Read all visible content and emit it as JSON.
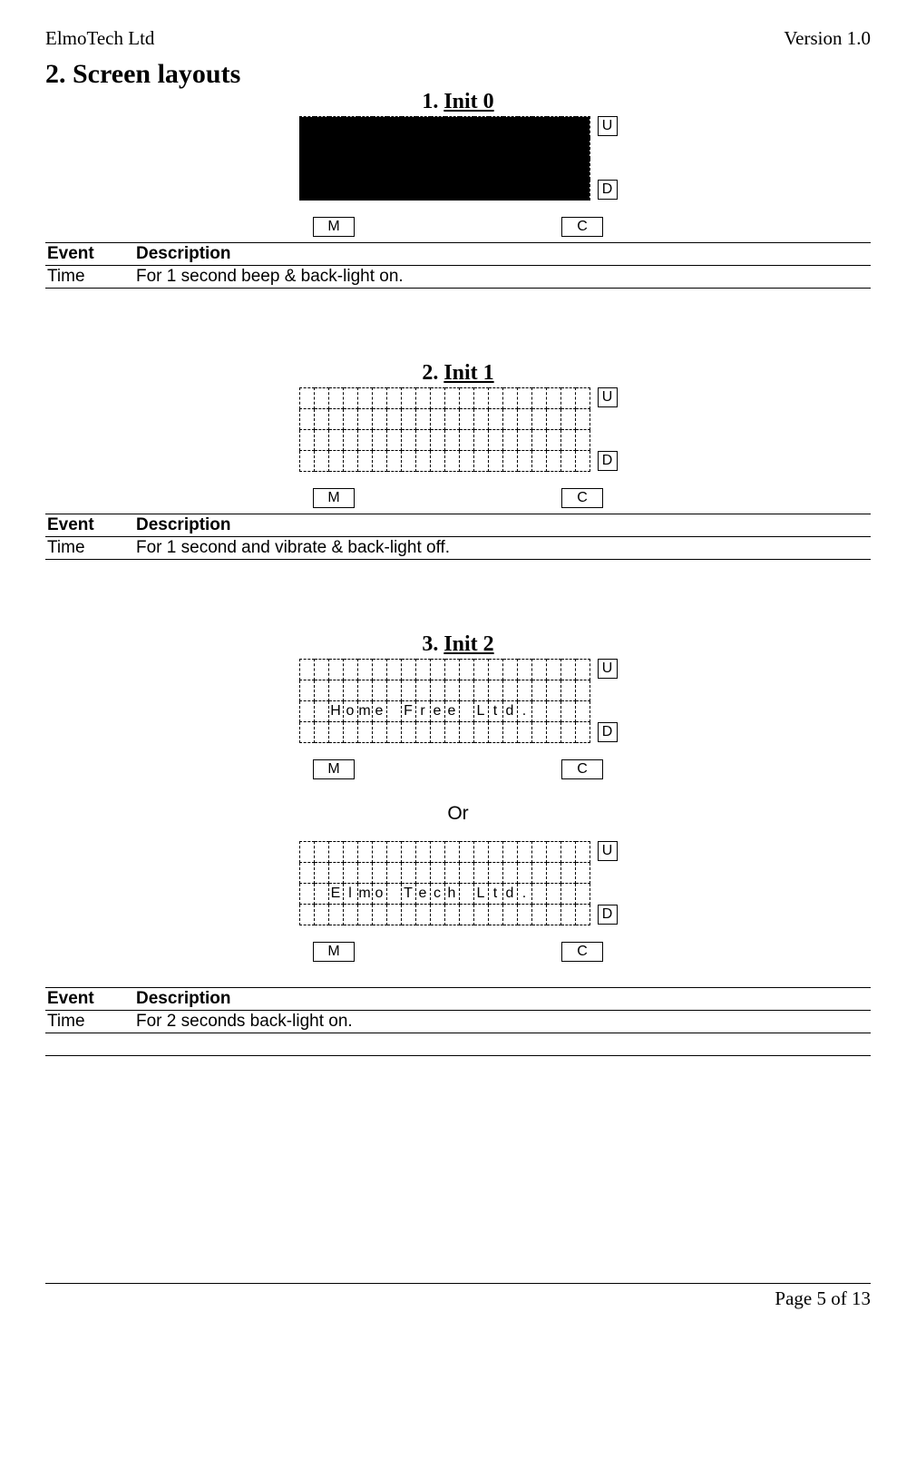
{
  "header": {
    "left": "ElmoTech Ltd",
    "right": "Version 1.0"
  },
  "section_title": "2. Screen layouts",
  "buttons": {
    "U": "U",
    "D": "D",
    "M": "M",
    "C": "C"
  },
  "screens": {
    "s0": {
      "num": "1.",
      "name": "Init 0",
      "cols": 20,
      "rows": 4,
      "filled": true
    },
    "s1": {
      "num": "2.",
      "name": "Init 1",
      "cols": 20,
      "rows": 4,
      "text_row": -1,
      "text": ""
    },
    "s2a": {
      "num": "3.",
      "name": "Init 2",
      "cols": 20,
      "rows": 4,
      "text_row": 2,
      "chars": [
        "",
        "",
        "H",
        "o",
        "m",
        "e",
        "",
        "F",
        "r",
        "e",
        "e",
        "",
        "L",
        "t",
        "d",
        ".",
        "",
        "",
        "",
        ""
      ]
    },
    "s2b": {
      "cols": 20,
      "rows": 4,
      "text_row": 2,
      "chars": [
        "",
        "",
        "E",
        "l",
        "m",
        "o",
        "",
        "T",
        "e",
        "c",
        "h",
        "",
        "L",
        "t",
        "d",
        ".",
        "",
        "",
        "",
        ""
      ]
    }
  },
  "or_label": "Or",
  "tables": {
    "header": {
      "event": "Event",
      "desc": "Description"
    },
    "t0": {
      "event": "Time",
      "desc": "For 1 second beep & back-light on."
    },
    "t1": {
      "event": "Time",
      "desc": "For 1 second and vibrate & back-light off."
    },
    "t2": {
      "event": "Time",
      "desc": "For 2 seconds back-light on."
    }
  },
  "footer": "Page 5 of 13"
}
